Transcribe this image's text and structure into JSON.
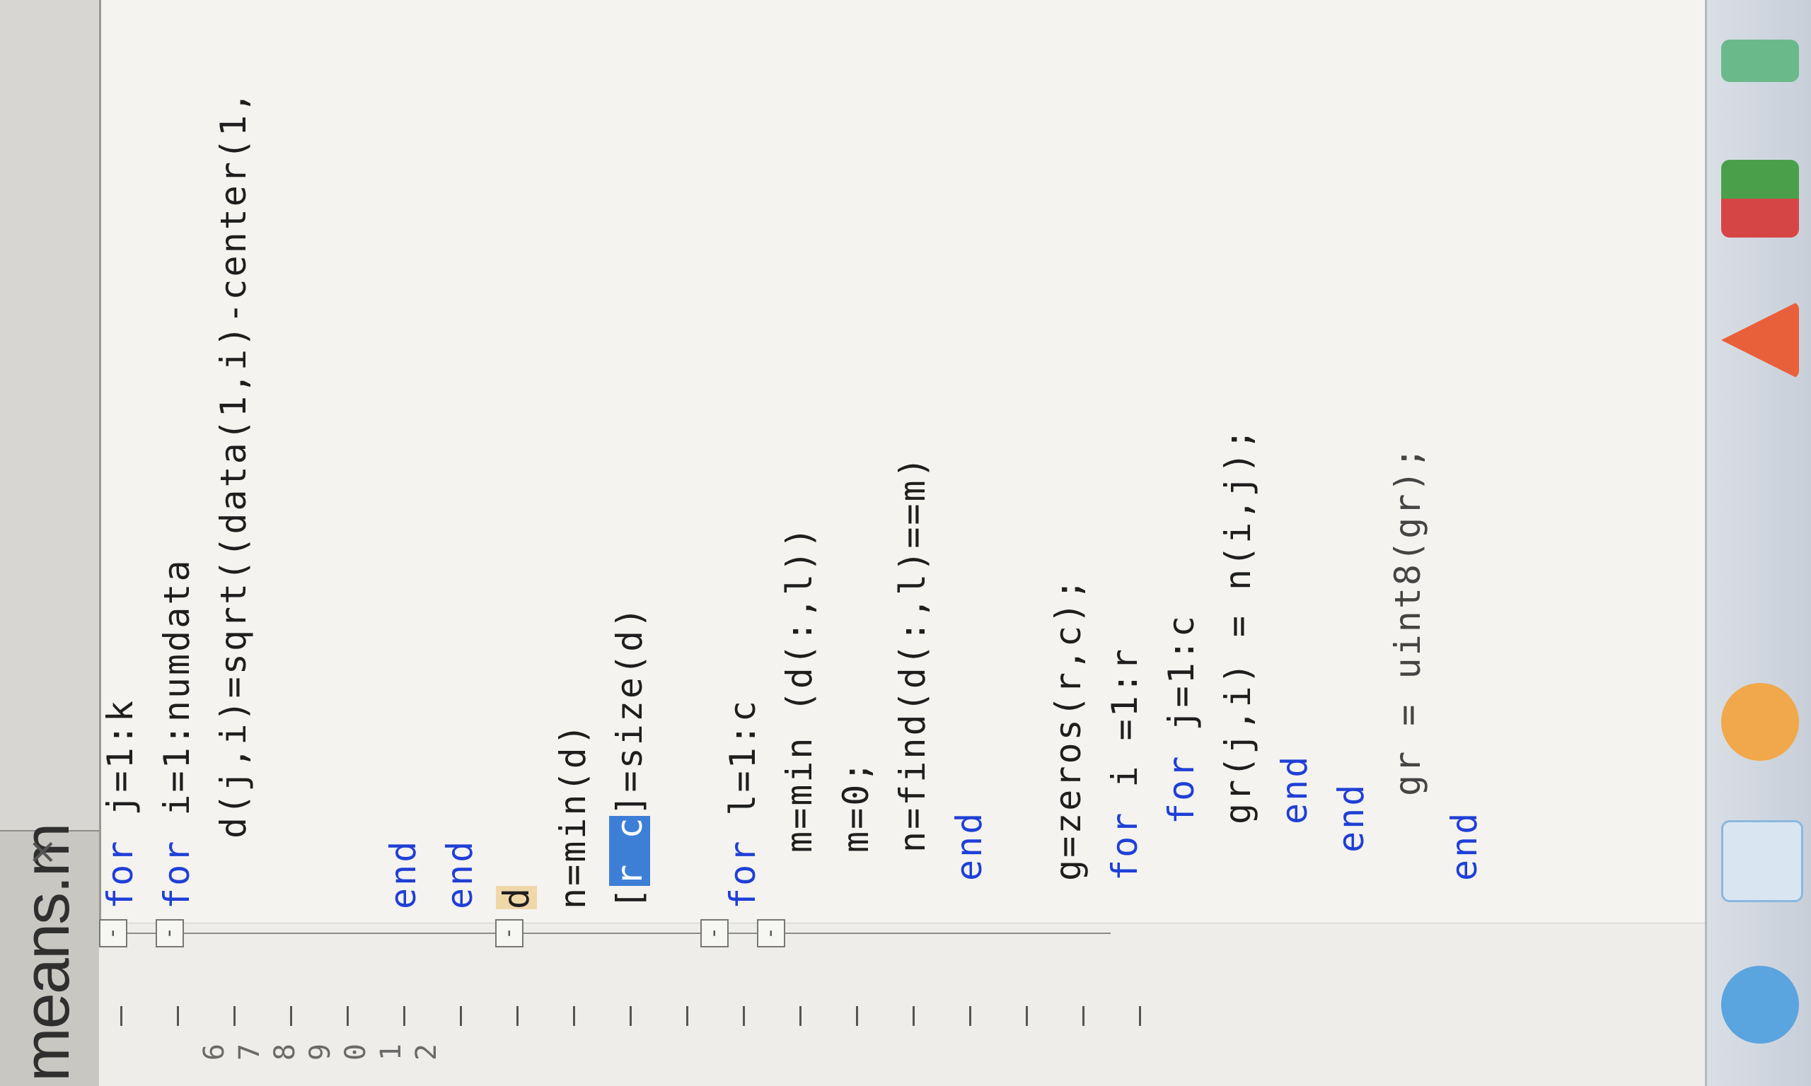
{
  "window": {
    "tab_title": "means.m",
    "close_glyph": "×"
  },
  "gutter": {
    "visible_numbers": [
      "6",
      "7",
      "8",
      "9",
      "0",
      "1",
      "2"
    ]
  },
  "code_lines": [
    "for j=1:k",
    "for i=1:numdata",
    "d(j,i)=sqrt((data(1,i)-center(1,",
    "end",
    "end",
    "d",
    "n=min(d)",
    "[r c]=size(d)",
    "for l=1:c",
    "m=min (d(:,l))",
    "m=0;",
    "n=find(d(:,l)==m)",
    "end",
    "g=zeros(r,c);",
    "for i =1:r",
    "for j=1:c",
    "gr(j,i) = n(i,j);",
    "end",
    "end",
    "gr = uint8(gr);",
    "end"
  ],
  "colors": {
    "keyword": "#1f3fd6",
    "selection": "#3d7fd6",
    "highlight": "#f0d7a8"
  },
  "icons": {
    "close": "close-icon",
    "fold": "fold-toggle-icon"
  }
}
